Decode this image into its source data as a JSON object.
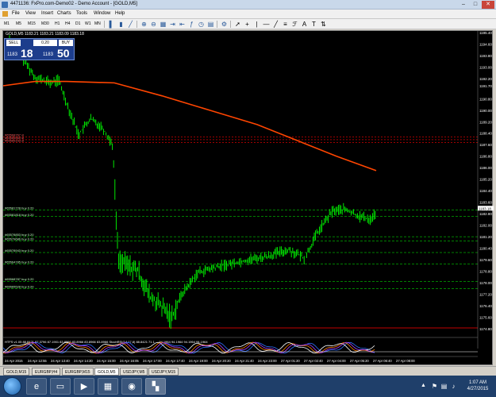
{
  "window": {
    "title": "4471136: FxPro.com-Demo02 - Demo Account - [GOLD,M5]",
    "min_label": "–",
    "max_label": "□",
    "close_label": "✕"
  },
  "menu": [
    "File",
    "View",
    "Insert",
    "Charts",
    "Tools",
    "Window",
    "Help"
  ],
  "timeframes": [
    "M1",
    "M5",
    "M15",
    "M30",
    "H1",
    "H4",
    "D1",
    "W1",
    "MN"
  ],
  "chart": {
    "label": "GOLD,M5  1183.21 1183.21 1183.09 1183.18",
    "price_axis": [
      "1195.40",
      "1194.60",
      "1193.80",
      "1193.00",
      "1192.20",
      "1191.70",
      "1190.80",
      "1190.00",
      "1189.20",
      "1188.40",
      "1187.60",
      "1186.80",
      "1186.00",
      "1185.20",
      "1184.40",
      "1183.60",
      "1182.80",
      "1182.00",
      "1181.20",
      "1180.40",
      "1179.60",
      "1178.80",
      "1178.00",
      "1177.20",
      "1176.40",
      "1175.60",
      "1174.80"
    ],
    "current_price": "1183.18",
    "time_axis": [
      "24 Apr 2015",
      "24 Apr 12:55",
      "24 Apr 13:40",
      "24 Apr 14:20",
      "24 Apr 15:00",
      "24 Apr 16:05",
      "24 Apr 17:00",
      "24 Apr 17:40",
      "24 Apr 19:00",
      "24 Apr 20:20",
      "24 Apr 21:40",
      "24 Apr 23:00",
      "27 Apr 01:20",
      "27 Apr 02:40",
      "27 Apr 04:00",
      "27 Apr 05:20",
      "27 Apr 06:40",
      "27 Apr 08:00"
    ],
    "order_lines": [
      "#65568767 sl",
      "#65565560 sl",
      "#65565153 sl",
      "#65581728 buy 0.20",
      "#65581818 buy 0.20",
      "#65578853 buy 0.20",
      "#65579686 buy 0.20",
      "#65578943 buy 0.20",
      "#65564785 buy 0.20",
      "#65568787 buy 0.20",
      "#65565528 buy 0.20"
    ],
    "indicator_label": "HTFS v1.05 88.8421 87.3796 87.1901 83.8966 83.8966 83.8966 83.8966 StochRSI(14,17,8) 88.8421 71.1 ... 94.1964 94.1964 94.1964 94.1964"
  },
  "oneclick": {
    "sell_label": "SELL",
    "buy_label": "BUY",
    "lots": "0.20",
    "bid_prefix": "1183",
    "bid_big": "18",
    "ask_prefix": "1183",
    "ask_big": "50"
  },
  "tabs": [
    "GOLD,M15",
    "EURGBP,H4",
    "EURGBP,M15",
    "GOLD,M5",
    "USDJPY,M5",
    "USDJPY,M15"
  ],
  "active_tab": 3,
  "taskbar": {
    "time": "1:07 AM",
    "date": "4/27/2015"
  },
  "colors": {
    "candles": "#00ff00",
    "ma_line": "#ff4500",
    "sl_lines": "#ff0000",
    "order_lines": "#00ff00",
    "background": "#000000"
  }
}
